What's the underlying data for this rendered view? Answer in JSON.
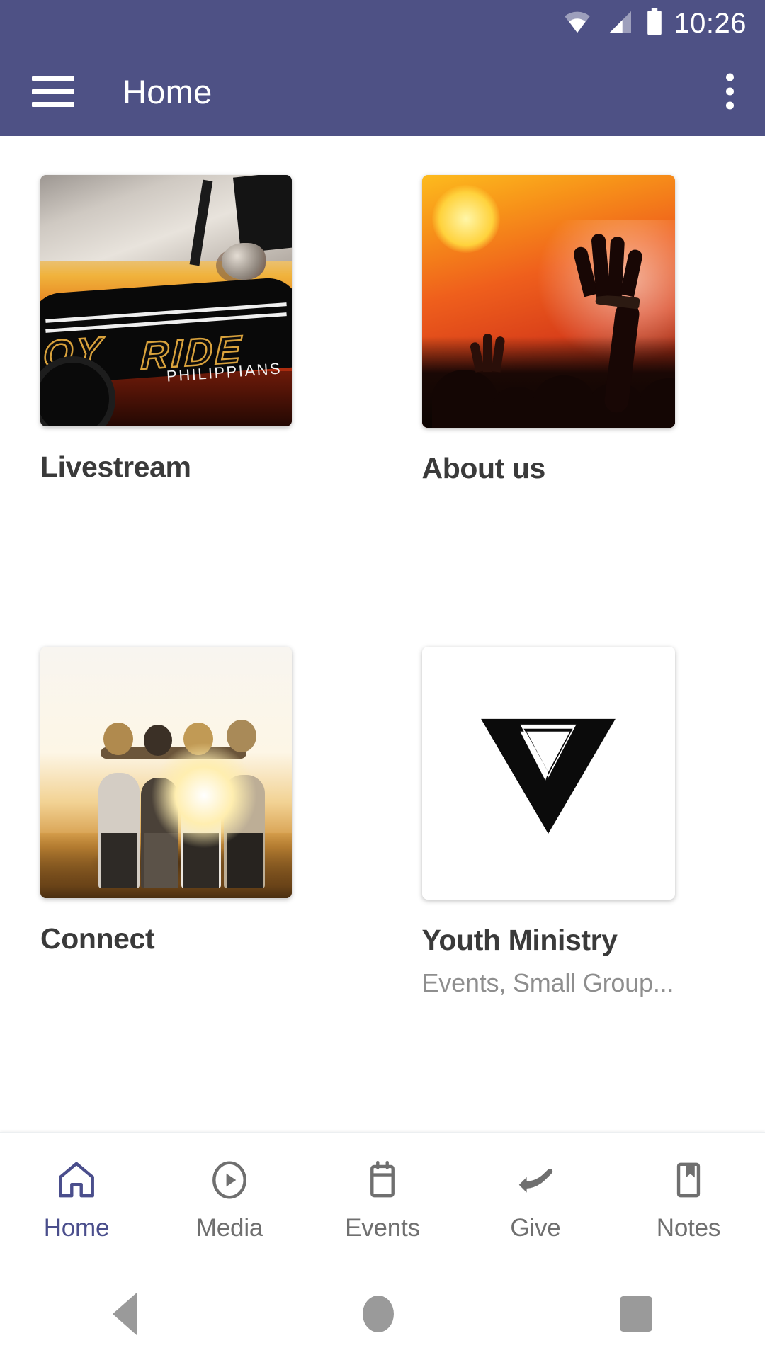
{
  "status_bar": {
    "time": "10:26",
    "icons": [
      "wifi-icon",
      "cellular-signal-icon",
      "battery-icon"
    ]
  },
  "app_bar": {
    "title": "Home",
    "menu_icon": "hamburger-menu-icon",
    "overflow_icon": "more-options-icon",
    "background_color": "#4E5185"
  },
  "home_grid": {
    "tiles": [
      {
        "title": "Livestream",
        "subtitle": "",
        "image_alt": "JOY RIDE PHILIPPIANS classic car sermon series artwork",
        "image_text": {
          "line1": "OY",
          "line2": "RIDE",
          "line3": "PHILIPPIANS"
        }
      },
      {
        "title": "About us",
        "subtitle": "",
        "image_alt": "Worship crowd with raised hands at sunset"
      },
      {
        "title": "Connect",
        "subtitle": "",
        "image_alt": "Four friends with arms around each other at sunset"
      },
      {
        "title": "Youth Ministry",
        "subtitle": "Events, Small Group...",
        "image_alt": "Black inverted triangle V logo"
      }
    ]
  },
  "tab_bar": {
    "items": [
      {
        "label": "Home",
        "icon": "home-icon",
        "active": true
      },
      {
        "label": "Media",
        "icon": "play-circle-icon",
        "active": false
      },
      {
        "label": "Events",
        "icon": "calendar-icon",
        "active": false
      },
      {
        "label": "Give",
        "icon": "giving-hand-icon",
        "active": false
      },
      {
        "label": "Notes",
        "icon": "bookmark-notes-icon",
        "active": false
      }
    ],
    "active_color": "#4a4e8c",
    "inactive_color": "#6f6f6f"
  },
  "system_nav": {
    "back": "back-button",
    "home": "home-button",
    "recents": "recents-button"
  }
}
